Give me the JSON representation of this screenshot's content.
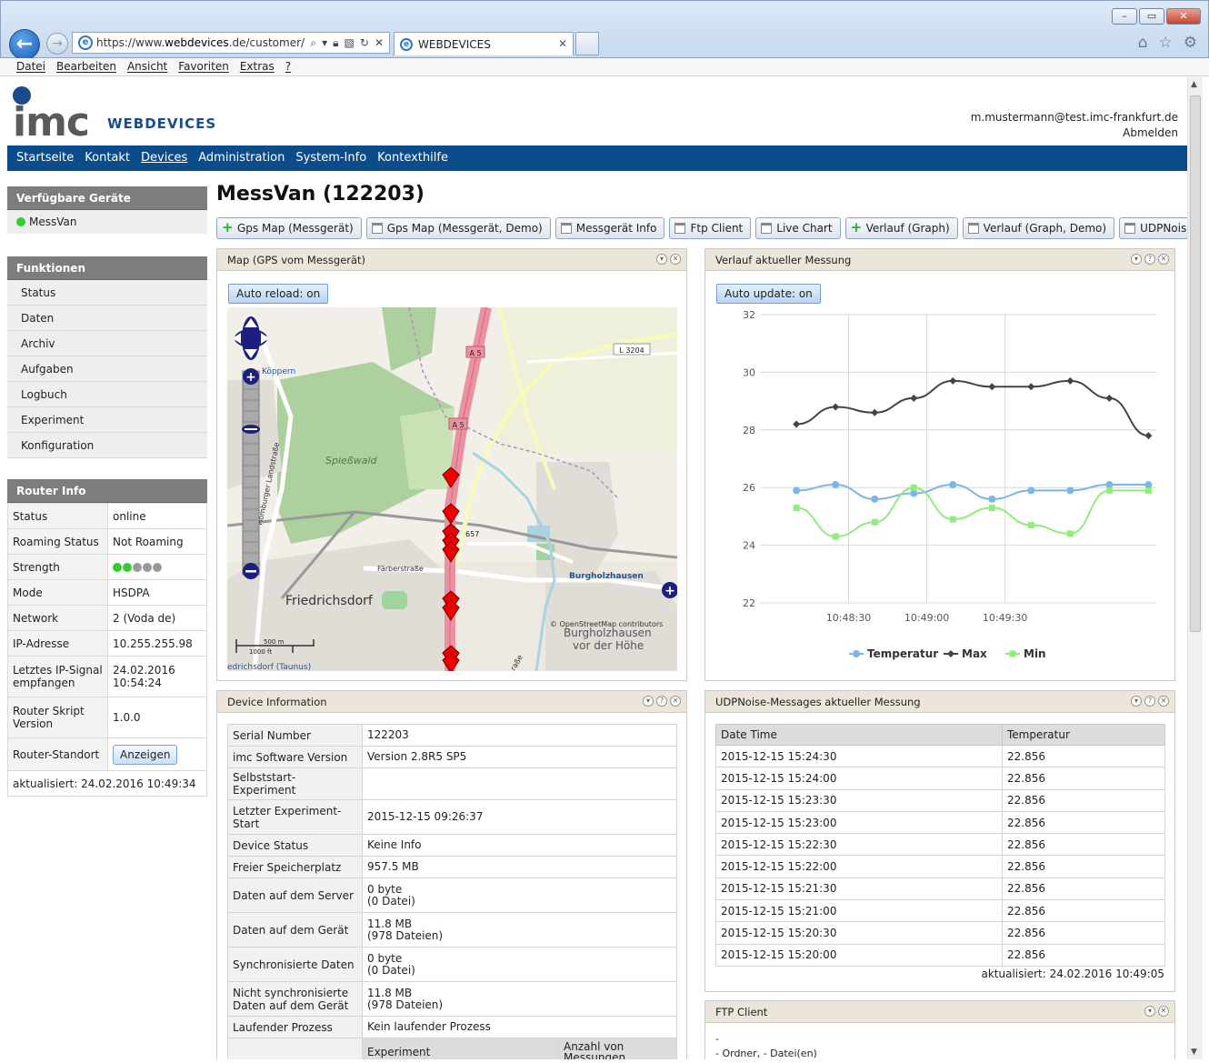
{
  "browser": {
    "url_prefix": "https://www.",
    "url_domain": "webdevices",
    "url_rest": ".de/customer/de",
    "tab_title": "WEBDEVICES",
    "menu": [
      "Datei",
      "Bearbeiten",
      "Ansicht",
      "Favoriten",
      "Extras",
      "?"
    ]
  },
  "header": {
    "logo": "imc",
    "logo_sub": "WEBDEVICES",
    "user_email": "m.mustermann@test.imc-frankfurt.de",
    "logout": "Abmelden"
  },
  "nav": [
    "Startseite",
    "Kontakt",
    "Devices",
    "Administration",
    "System-Info",
    "Kontexthilfe"
  ],
  "sidebar": {
    "devices_title": "Verfügbare Geräte",
    "device": "MessVan",
    "functions_title": "Funktionen",
    "functions": [
      "Status",
      "Daten",
      "Archiv",
      "Aufgaben",
      "Logbuch",
      "Experiment",
      "Konfiguration"
    ],
    "router_title": "Router Info",
    "router_rows": [
      {
        "k": "Status",
        "v": "online"
      },
      {
        "k": "Roaming Status",
        "v": "Not Roaming"
      },
      {
        "k": "Strength",
        "v": ""
      },
      {
        "k": "Mode",
        "v": "HSDPA"
      },
      {
        "k": "Network",
        "v": "2 (Voda de)"
      },
      {
        "k": "IP-Adresse",
        "v": "10.255.255.98"
      },
      {
        "k": "Letztes IP-Signal empfangen",
        "v": "24.02.2016 10:54:24"
      },
      {
        "k": "Router Skript Version",
        "v": "1.0.0"
      }
    ],
    "strength_level": 2,
    "strength_max": 5,
    "router_location": "Router-Standort",
    "show_button": "Anzeigen",
    "updated": "aktualisiert: 24.02.2016 10:49:34"
  },
  "main": {
    "title": "MessVan (122203)",
    "toolbar": [
      {
        "icon": "plus",
        "label": "Gps Map (Messgerät)"
      },
      {
        "icon": "doc",
        "label": "Gps Map (Messgerät, Demo)"
      },
      {
        "icon": "doc",
        "label": "Messgerät Info"
      },
      {
        "icon": "doc",
        "label": "Ftp Client"
      },
      {
        "icon": "doc",
        "label": "Live Chart"
      },
      {
        "icon": "plus",
        "label": "Verlauf (Graph)"
      },
      {
        "icon": "doc",
        "label": "Verlauf (Graph, Demo)"
      },
      {
        "icon": "doc",
        "label": "UDPNoise-Messages"
      }
    ]
  },
  "map_panel": {
    "title": "Map (GPS vom Messgerät)",
    "auto_reload": "Auto reload: on",
    "labels": {
      "koeppern": "Köppern",
      "spiesswald": "Spießwald",
      "friedrichsdorf": "Friedrichsdorf",
      "friedrichsdorf_taunus": "edrichsdorf (Taunus)",
      "burgholzhausen": "Burgholzhausen",
      "burgholzhausen2": "Burgholzhausen",
      "vor_der_hoehe": "vor der Höhe",
      "faerberstrasse": "Färberstraße",
      "homburger": "Homburger Landstraße",
      "a5": "A 5",
      "l3204": "L 3204",
      "n657": "657",
      "attribution": "© OpenStreetMap contributors",
      "scale_m": "500 m",
      "scale_ft": "1000 ft",
      "strasse": "raße"
    }
  },
  "chart_panel": {
    "title": "Verlauf aktueller Messung",
    "auto_update": "Auto update: on"
  },
  "chart_data": {
    "type": "line",
    "x_unit": "time",
    "x": [
      "10:48:10",
      "10:48:25",
      "10:48:40",
      "10:48:55",
      "10:49:10",
      "10:49:25",
      "10:49:40",
      "10:49:55",
      "10:50:10",
      "10:50:25"
    ],
    "xticks": [
      "10:48:30",
      "10:49:00",
      "10:49:30"
    ],
    "ylim": [
      22,
      32
    ],
    "yticks": [
      22,
      24,
      26,
      28,
      30,
      32
    ],
    "legend_position": "bottom",
    "grid": true,
    "series": [
      {
        "name": "Temperatur",
        "color": "#7cb5ec",
        "marker": "circle",
        "values": [
          25.9,
          26.1,
          25.6,
          25.8,
          26.1,
          25.6,
          25.9,
          25.9,
          26.1,
          26.1
        ]
      },
      {
        "name": "Max",
        "color": "#434348",
        "marker": "diamond",
        "values": [
          28.2,
          28.8,
          28.6,
          29.1,
          29.7,
          29.5,
          29.5,
          29.7,
          29.1,
          27.8
        ]
      },
      {
        "name": "Min",
        "color": "#90ed7d",
        "marker": "square",
        "values": [
          25.3,
          24.3,
          24.8,
          26.0,
          24.9,
          25.3,
          24.7,
          24.4,
          25.9,
          25.9
        ]
      }
    ]
  },
  "device_info": {
    "title": "Device Information",
    "rows": [
      {
        "k": "Serial Number",
        "v": "122203"
      },
      {
        "k": "imc Software Version",
        "v": "Version 2.8R5 SP5"
      },
      {
        "k": "Selbststart-Experiment",
        "v": ""
      },
      {
        "k": "Letzter Experiment-Start",
        "v": "2015-12-15 09:26:37"
      },
      {
        "k": "Device Status",
        "v": "Keine Info"
      },
      {
        "k": "Freier Speicherplatz",
        "v": "957.5 MB"
      },
      {
        "k": "Daten auf dem Server",
        "v": "0 byte\n(0 Datei)"
      },
      {
        "k": "Daten auf dem Gerät",
        "v": "11.8 MB\n(978 Dateien)"
      },
      {
        "k": "Synchronisierte Daten",
        "v": "0 byte\n(0 Datei)"
      },
      {
        "k": "Nicht synchronisierte Daten auf dem Gerät",
        "v": "11.8 MB\n(978 Dateien)"
      },
      {
        "k": "Laufender Prozess",
        "v": "Kein laufender Prozess"
      }
    ],
    "sub_headers": [
      "Experiment",
      "Anzahl von Messungen"
    ]
  },
  "udp_panel": {
    "title": "UDPNoise-Messages aktueller Messung",
    "columns": [
      "Date Time",
      "Temperatur"
    ],
    "rows": [
      [
        "2015-12-15 15:24:30",
        "22.856"
      ],
      [
        "2015-12-15 15:24:00",
        "22.856"
      ],
      [
        "2015-12-15 15:23:30",
        "22.856"
      ],
      [
        "2015-12-15 15:23:00",
        "22.856"
      ],
      [
        "2015-12-15 15:22:30",
        "22.856"
      ],
      [
        "2015-12-15 15:22:00",
        "22.856"
      ],
      [
        "2015-12-15 15:21:30",
        "22.856"
      ],
      [
        "2015-12-15 15:21:00",
        "22.856"
      ],
      [
        "2015-12-15 15:20:30",
        "22.856"
      ],
      [
        "2015-12-15 15:20:00",
        "22.856"
      ]
    ],
    "updated": "aktualisiert: 24.02.2016 10:49:05"
  },
  "ftp_panel": {
    "title": "FTP Client",
    "line1": "-",
    "line2": "- Ordner, - Datei(en)"
  }
}
